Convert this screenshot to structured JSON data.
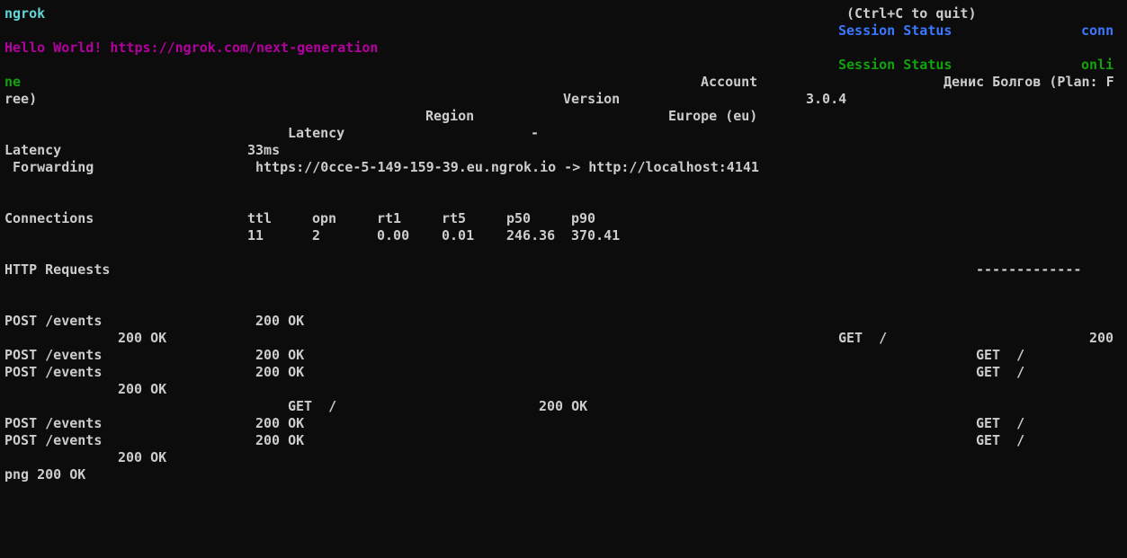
{
  "terminal": {
    "app_name": "ngrok",
    "quit_hint": "(Ctrl+C to quit)",
    "announcement": "Hello World! https://ngrok.com/next-generation",
    "session_status_label_1": "Session Status",
    "session_status_value_1": "conn",
    "session_status_label_2": "Session Status",
    "session_status_value_2_part1": "onli",
    "session_status_value_2_part2": "ne",
    "account_label": "Account",
    "account_value_part1": "Денис Болгов (Plan: F",
    "account_value_part2": "ree)",
    "version_label": "Version",
    "version_value": "3.0.4",
    "region_label": "Region",
    "region_value": "Europe (eu)",
    "latency_label_1": "Latency",
    "latency_value_1": "-",
    "latency_label_2": "Latency",
    "latency_value_2": "33ms",
    "forwarding_label": " Forwarding",
    "forwarding_value": "https://0cce-5-149-159-39.eu.ngrok.io -> http://localhost:4141",
    "connections": {
      "label": "Connections",
      "headers": [
        "ttl",
        "opn",
        "rt1",
        "rt5",
        "p50",
        "p90"
      ],
      "values": [
        "11",
        "2",
        "0.00",
        "0.01",
        "246.36",
        "370.41"
      ]
    },
    "http_requests": {
      "label": "HTTP Requests",
      "divider": "-------------",
      "lines": [
        "POST /events",
        "200 OK",
        "200 OK",
        "GET  /",
        "200",
        "POST /events",
        "200 OK",
        "GET  /",
        "POST /events",
        "200 OK",
        "GET  /",
        "200 OK",
        "GET  /",
        "200 OK",
        "POST /events",
        "200 OK",
        "GET  /",
        "POST /events",
        "200 OK",
        "GET  /",
        "200 OK",
        "png 200 OK"
      ]
    }
  }
}
